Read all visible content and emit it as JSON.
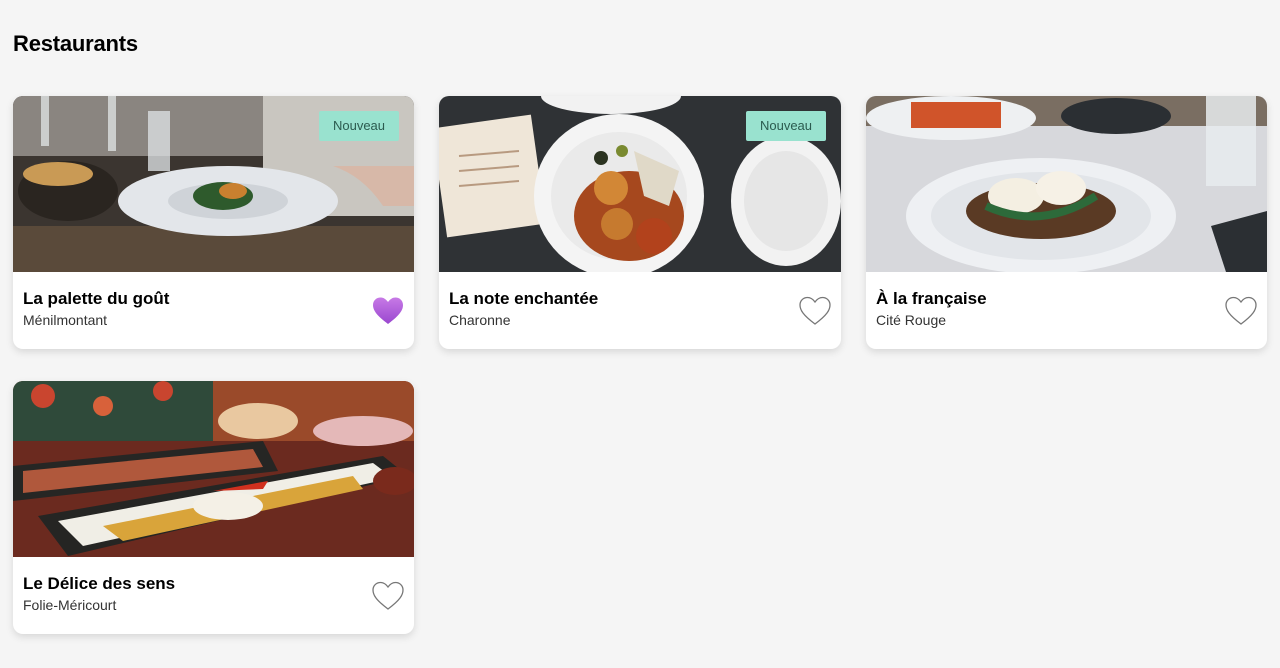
{
  "page": {
    "title": "Restaurants"
  },
  "colors": {
    "badge_bg": "#99e2cf",
    "favorite_active": "#b565dd",
    "favorite_inactive": "#777777",
    "background": "#f5f5f5"
  },
  "restaurants": [
    {
      "name": "La palette du goût",
      "area": "Ménilmontant",
      "badge": "",
      "favorite": true,
      "icon": "heart-icon"
    },
    {
      "name": "La note enchantée",
      "area": "Charonne",
      "badge": "Nouveau",
      "favorite": false,
      "icon": "heart-icon"
    },
    {
      "name": "À la française",
      "area": "Cité Rouge",
      "badge": "",
      "favorite": false,
      "icon": "heart-icon"
    },
    {
      "name": "Le Délice des sens",
      "area": "Folie-Méricourt",
      "badge": "",
      "favorite": false,
      "icon": "heart-icon"
    }
  ],
  "first_card_badge": "Nouveau"
}
